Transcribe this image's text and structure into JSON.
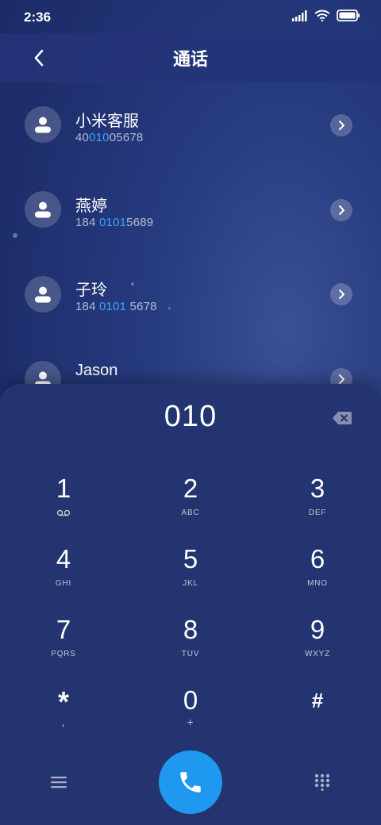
{
  "status_bar": {
    "time": "2:36"
  },
  "header": {
    "title": "通话"
  },
  "contacts": [
    {
      "name": "小米客服",
      "number_pre": "40",
      "number_match": "010",
      "number_post": "05678"
    },
    {
      "name": "燕婷",
      "number_pre": "184 ",
      "number_match": "0101",
      "number_post": "5689"
    },
    {
      "name": "子玲",
      "number_pre": "184 ",
      "number_match": "0101",
      "number_post": " 5678"
    },
    {
      "name": "Jason",
      "number_pre": "",
      "number_match": "",
      "number_post": ""
    }
  ],
  "dialpad": {
    "input": "010",
    "keys": [
      {
        "digit": "1",
        "sub": ""
      },
      {
        "digit": "2",
        "sub": "ABC"
      },
      {
        "digit": "3",
        "sub": "DEF"
      },
      {
        "digit": "4",
        "sub": "GHI"
      },
      {
        "digit": "5",
        "sub": "JKL"
      },
      {
        "digit": "6",
        "sub": "MNO"
      },
      {
        "digit": "7",
        "sub": "PQRS"
      },
      {
        "digit": "8",
        "sub": "TUV"
      },
      {
        "digit": "9",
        "sub": "WXYZ"
      },
      {
        "digit": "*",
        "sub": ","
      },
      {
        "digit": "0",
        "sub": "+"
      },
      {
        "digit": "#",
        "sub": ""
      }
    ]
  },
  "icons": {
    "back": "chevron-left-icon",
    "backspace": "backspace-icon",
    "menu": "menu-icon",
    "keypad": "keypad-icon",
    "call": "phone-icon",
    "voicemail": "voicemail-icon"
  },
  "colors": {
    "accent": "#1f98f0",
    "match_highlight": "#3aa5ff",
    "panel": "#243471"
  }
}
